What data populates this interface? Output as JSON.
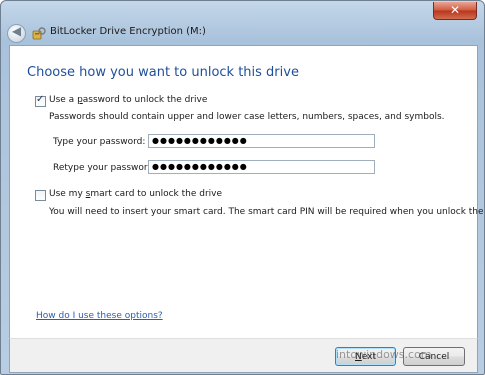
{
  "window": {
    "title": "BitLocker Drive Encryption (M:)",
    "close_glyph": "✕",
    "back_glyph": "◀"
  },
  "page": {
    "heading": "Choose how you want to unlock this drive"
  },
  "password_option": {
    "checked": true,
    "label_pre": "Use a ",
    "label_key": "p",
    "label_post": "assword to unlock the drive",
    "hint": "Passwords should contain upper and lower case letters, numbers, spaces, and symbols.",
    "type_label": "Type your password:",
    "type_value": "●●●●●●●●●●●●",
    "retype_label": "Retype your password:",
    "retype_value": "●●●●●●●●●●●●"
  },
  "smartcard_option": {
    "checked": false,
    "label_pre": "Use my ",
    "label_key": "s",
    "label_post": "mart card to unlock the drive",
    "hint": "You will need to insert your smart card. The smart card PIN will be required when you unlock the drive."
  },
  "help_link": "How do I use these options?",
  "buttons": {
    "next_key": "N",
    "next_rest": "ext",
    "cancel": "Cancel"
  },
  "watermark": "intowindows.com",
  "colors": {
    "heading": "#1f4f9a",
    "link": "#2a5fb0",
    "titlebar": "#b9cde2"
  }
}
